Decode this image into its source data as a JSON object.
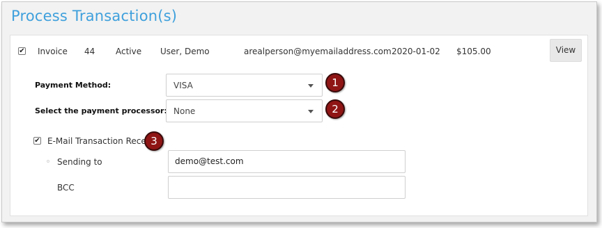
{
  "page": {
    "title": "Process Transaction(s)"
  },
  "transaction": {
    "type": "Invoice",
    "number": "44",
    "status": "Active",
    "name": "User, Demo",
    "email": "arealperson@myemailaddress.com",
    "date": "2020-01-02",
    "amount": "$105.00",
    "view_label": "View",
    "checked": "✔"
  },
  "payment": {
    "method_label": "Payment Method:",
    "method_value": "VISA",
    "processor_label": "Select the payment processor:",
    "processor_value": "None"
  },
  "receipt": {
    "checked": "✔",
    "label": "E-Mail Transaction Receipt",
    "sending_to_label": "Sending to",
    "sending_to_value": "demo@test.com",
    "bcc_label": "BCC",
    "bcc_value": ""
  },
  "markers": [
    "1",
    "2",
    "3"
  ],
  "colors": {
    "title": "#3fa0dc",
    "marker": "#8f1515"
  }
}
